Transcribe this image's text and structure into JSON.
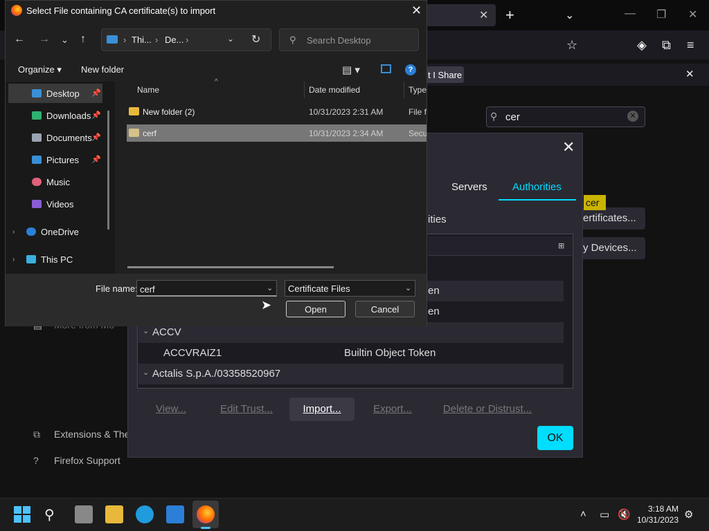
{
  "firefox": {
    "notification_pill": "t I Share",
    "search_value": "cer",
    "highlight": "cer",
    "pref_buttons": [
      "ertificates...",
      "y Devices..."
    ],
    "sidebar": {
      "more_from": "More from Mo",
      "extensions": "Extensions & The",
      "support": "Firefox Support"
    }
  },
  "cert_manager": {
    "tabs": {
      "servers": "Servers",
      "authorities": "Authorities"
    },
    "description_fragment": "ities",
    "rows": [
      {
        "kind": "partial",
        "text": "en"
      },
      {
        "kind": "partial",
        "text": "en"
      },
      {
        "kind": "group",
        "name": "ACCV"
      },
      {
        "kind": "cert",
        "name": "ACCVRAIZ1",
        "token": "Builtin Object Token"
      },
      {
        "kind": "group",
        "name": "Actalis S.p.A./03358520967"
      }
    ],
    "buttons": {
      "view": "View...",
      "edit_trust": "Edit Trust...",
      "import": "Import...",
      "export": "Export...",
      "delete": "Delete or Distrust...",
      "ok": "OK"
    }
  },
  "file_dialog": {
    "title": "Select File containing CA certificate(s) to import",
    "breadcrumb": [
      "Thi...",
      "De..."
    ],
    "search_placeholder": "Search Desktop",
    "toolbar": {
      "organize": "Organize",
      "new_folder": "New folder"
    },
    "nav_pane": {
      "quick_access": [
        {
          "label": "Desktop",
          "icon": "desktop-icon",
          "color": "#3a8fd6"
        },
        {
          "label": "Downloads",
          "icon": "download-icon",
          "color": "#2fb170"
        },
        {
          "label": "Documents",
          "icon": "documents-icon",
          "color": "#9aa4b2"
        },
        {
          "label": "Pictures",
          "icon": "pictures-icon",
          "color": "#3a8fd6"
        },
        {
          "label": "Music",
          "icon": "music-icon",
          "color": "#e0617a"
        },
        {
          "label": "Videos",
          "icon": "videos-icon",
          "color": "#8a5cd6"
        }
      ],
      "onedrive": "OneDrive",
      "this_pc": "This PC"
    },
    "columns": {
      "name": "Name",
      "date": "Date modified",
      "type": "Type"
    },
    "files": [
      {
        "name": "New folder (2)",
        "date": "10/31/2023 2:31 AM",
        "type": "File fo",
        "icon_color": "#e8b83a"
      },
      {
        "name": "cerf",
        "date": "10/31/2023 2:34 AM",
        "type": "Secu",
        "icon_color": "#d6c18a"
      }
    ],
    "file_name_label": "File name:",
    "file_name_value": "cerf",
    "file_type": "Certificate Files",
    "open": "Open",
    "cancel": "Cancel"
  },
  "taskbar": {
    "time": "3:18 AM",
    "date": "10/31/2023"
  }
}
